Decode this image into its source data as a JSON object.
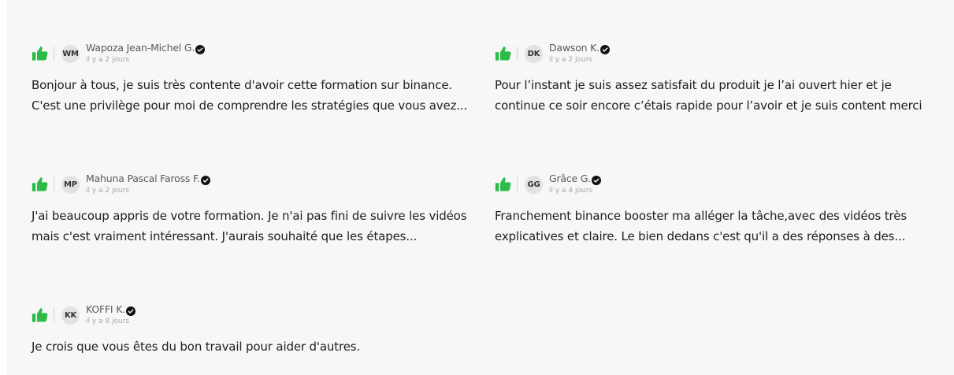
{
  "colors": {
    "accent_green": "#2dbb47",
    "verified_badge": "#111111",
    "panel_bg": "#f7f7f7"
  },
  "reviews": [
    {
      "initials": "WM",
      "name": "Wapoza Jean-Michel G.",
      "date": "il y a 2 jours",
      "lines": [
        "Bonjour à tous, je suis très contente d'avoir cette formation sur binance.",
        "C'est une privilège pour moi de comprendre les stratégies que vous avez..."
      ]
    },
    {
      "initials": "DK",
      "name": "Dawson K.",
      "date": "il y a 2 jours",
      "lines": [
        "Pour l’instant je suis assez satisfait du produit je l’ai ouvert hier et je",
        "continue ce soir encore c’étais rapide pour l’avoir et je suis content merci"
      ]
    },
    {
      "initials": "MP",
      "name": "Mahuna Pascal Faross F.",
      "date": "il y a 2 jours",
      "lines": [
        "J'ai beaucoup appris de votre formation. Je n'ai pas fini de suivre les vidéos",
        "mais c'est vraiment intéressant. J'aurais souhaité que les étapes..."
      ]
    },
    {
      "initials": "GG",
      "name": "Grâce G.",
      "date": "il y a 4 jours",
      "lines": [
        "Franchement binance booster ma alléger la tâche,avec des vidéos très",
        "explicatives et claire. Le bien dedans c'est qu'il a des réponses à des..."
      ]
    },
    {
      "initials": "KK",
      "name": "KOFFI K.",
      "date": "il y a 8 jours",
      "lines": [
        "Je crois que vous êtes du bon travail pour aider d'autres."
      ]
    }
  ]
}
